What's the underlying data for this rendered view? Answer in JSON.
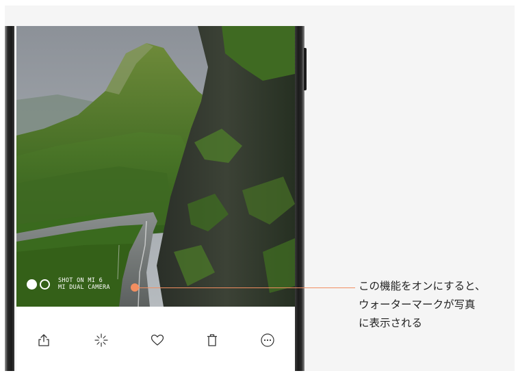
{
  "photo": {
    "watermark": {
      "line1": "SHOT ON MI 6",
      "line2": "MI DUAL CAMERA",
      "logo_icon": "dual-circle-logo-icon"
    }
  },
  "toolbar": {
    "buttons": [
      {
        "name": "share",
        "icon": "share-icon"
      },
      {
        "name": "edit",
        "icon": "magic-wand-icon"
      },
      {
        "name": "favorite",
        "icon": "heart-icon"
      },
      {
        "name": "delete",
        "icon": "trash-icon"
      },
      {
        "name": "more",
        "icon": "more-icon"
      }
    ],
    "icon_color": "#333333"
  },
  "callout": {
    "lines": [
      "この機能をオンにすると、",
      "ウォーターマークが写真",
      "に表示される"
    ],
    "accent_color": "#f28e60"
  }
}
